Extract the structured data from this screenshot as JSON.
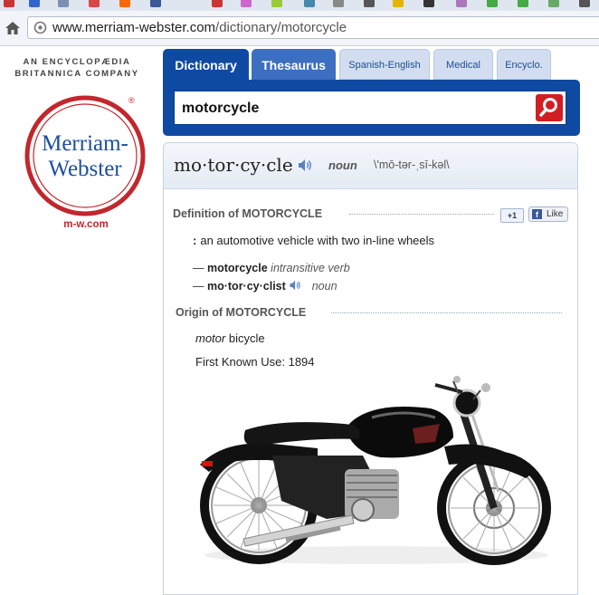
{
  "browser": {
    "url_host": "www.merriam-webster.com",
    "url_path": "/dictionary/motorcycle"
  },
  "brand": {
    "tagline_line1": "AN ENCYCLOPÆDIA",
    "tagline_line2": "BRITANNICA COMPANY",
    "logo_line1": "Merriam-",
    "logo_line2": "Webster",
    "registered": "®",
    "site_link": "m-w.com",
    "colors": {
      "red": "#c1272d",
      "blue": "#0f4aa2"
    }
  },
  "tabs": [
    {
      "label": "Dictionary",
      "active": true
    },
    {
      "label": "Thesaurus",
      "active": false
    },
    {
      "label": "Spanish-English",
      "active": false
    },
    {
      "label": "Medical",
      "active": false
    },
    {
      "label": "Encyclo.",
      "active": false
    }
  ],
  "search": {
    "value": "motorcycle",
    "button_icon": "search-icon"
  },
  "entry": {
    "headword": "mo·tor·cy·cle",
    "part_of_speech": "noun",
    "pronunciation": "\\'mō-tər-ˌsī-kəl\\",
    "definition_heading": "Definition of MOTORCYCLE",
    "gplus_label": "+1",
    "fb_label": "Like",
    "definition_marker": ":",
    "definition_text": "an automotive vehicle with two in-line wheels",
    "run_ons": [
      {
        "dash": "—",
        "word": "motorcycle",
        "label": "intransitive verb"
      },
      {
        "dash": "—",
        "word": "mo·tor·cy·clist",
        "label": "noun"
      }
    ],
    "origin_heading": "Origin of MOTORCYCLE",
    "etymology_word": "motor",
    "etymology_rest": "bicycle",
    "first_known_use": "First Known Use: 1894"
  }
}
